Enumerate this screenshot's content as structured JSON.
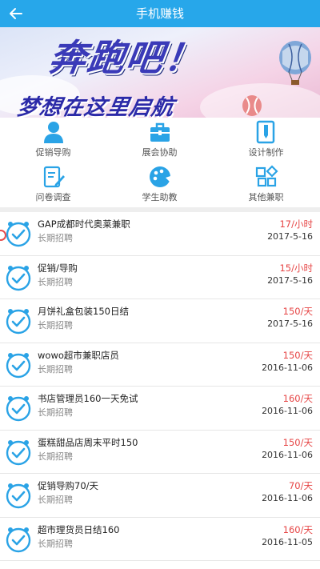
{
  "header": {
    "title": "手机赚钱",
    "back_icon": "arrow-left-icon"
  },
  "banner": {
    "headline": "奔跑吧！",
    "subline": "梦想在这里启航"
  },
  "categories": [
    {
      "label": "促销导购",
      "icon": "person-icon"
    },
    {
      "label": "展会协助",
      "icon": "briefcase-icon"
    },
    {
      "label": "设计制作",
      "icon": "design-doc-icon"
    },
    {
      "label": "问卷调查",
      "icon": "form-edit-icon"
    },
    {
      "label": "学生助教",
      "icon": "palette-icon"
    },
    {
      "label": "其他兼职",
      "icon": "grid-icon"
    }
  ],
  "jobs": [
    {
      "title": "GAP成都时代奥莱兼职",
      "sub": "长期招聘",
      "pay": "17/小时",
      "date": "2017-5-16"
    },
    {
      "title": "促销/导购",
      "sub": "长期招聘",
      "pay": "15/小时",
      "date": "2017-5-16"
    },
    {
      "title": "月饼礼盒包装150日结",
      "sub": "长期招聘",
      "pay": "150/天",
      "date": "2017-5-16"
    },
    {
      "title": "wowo超市兼职店员",
      "sub": "长期招聘",
      "pay": "150/天",
      "date": "2016-11-06"
    },
    {
      "title": "书店管理员160一天免试",
      "sub": "长期招聘",
      "pay": "160/天",
      "date": "2016-11-06"
    },
    {
      "title": "蛋糕甜品店周末平时150",
      "sub": "长期招聘",
      "pay": "150/天",
      "date": "2016-11-06"
    },
    {
      "title": "促销导购70/天",
      "sub": "长期招聘",
      "pay": "70/天",
      "date": "2016-11-06"
    },
    {
      "title": "超市理货员日结160",
      "sub": "长期招聘",
      "pay": "160/天",
      "date": "2016-11-05"
    }
  ],
  "colors": {
    "primary": "#27a7ea",
    "pay": "#e64545",
    "check_icon": "#2aa3e6"
  }
}
